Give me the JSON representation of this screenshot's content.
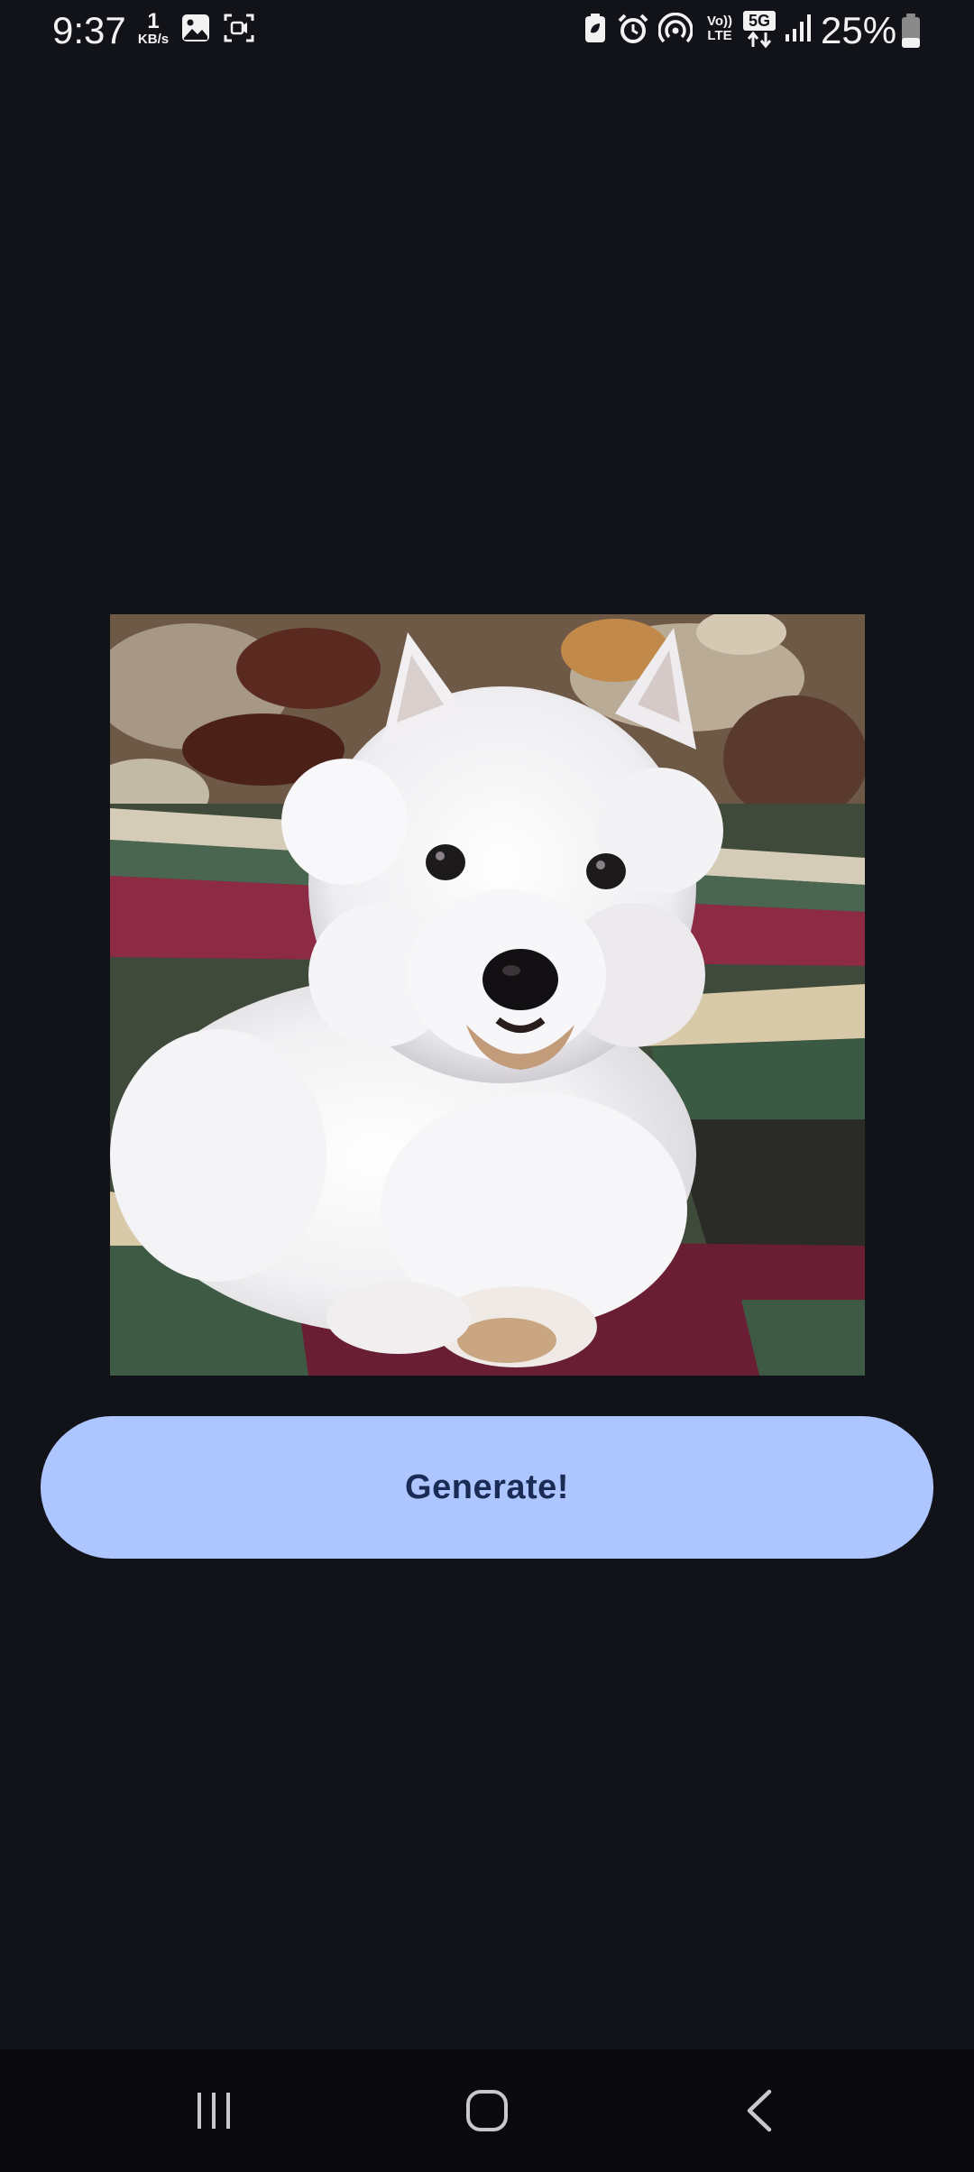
{
  "status_bar": {
    "time": "9:37",
    "net_speed_value": "1",
    "net_speed_unit": "KB/s",
    "volte_line1": "Vo))",
    "volte_line2": "LTE",
    "network_type": "5G",
    "battery_percent": "25%",
    "icons": [
      "gallery-icon",
      "screen-record-icon",
      "battery-saver-icon",
      "alarm-icon",
      "hotspot-icon",
      "volte-icon",
      "5g-icon",
      "signal-icon",
      "battery-icon"
    ]
  },
  "main": {
    "image_alt": "West Highland White Terrier",
    "generate_label": "Generate!"
  },
  "nav_bar": {
    "icons": [
      "recent-apps-icon",
      "home-icon",
      "back-icon"
    ]
  },
  "colors": {
    "background": "#121318",
    "button": "#adc6ff",
    "button_text": "#1a2c55",
    "nav_background": "#0a0a0c"
  }
}
